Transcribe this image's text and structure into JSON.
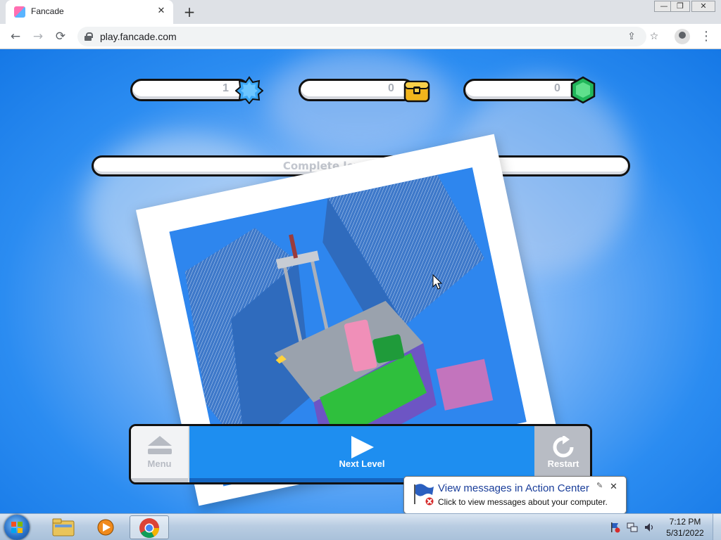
{
  "browser": {
    "tab_title": "Fancade",
    "url": "play.fancade.com",
    "favicon": "fancade-favicon",
    "buttons": {
      "back": "←",
      "forward": "→",
      "reload": "⟳",
      "close_tab": "✕",
      "new_tab": "+",
      "share": "⇪",
      "bookmark": "☆",
      "menu": "⋮"
    },
    "window_controls": {
      "minimize": "—",
      "restore": "❐",
      "close": "✕"
    }
  },
  "game": {
    "counters": {
      "stars": "1",
      "chests": "0",
      "gems": "0"
    },
    "progress_text": "Complete level to earn 1★",
    "buttons": {
      "menu": "Menu",
      "next": "Next Level",
      "restart": "Restart"
    },
    "colors": {
      "accent": "#1e8ef0",
      "star": "#3aa7f5",
      "chest": "#f2b51c",
      "gem": "#21b65a"
    }
  },
  "notification": {
    "title": "View messages in Action Center",
    "text": "Click to view messages about your computer.",
    "close": "✕",
    "pin": "✎"
  },
  "taskbar": {
    "time": "7:12 PM",
    "date": "5/31/2022",
    "apps": [
      "file-explorer",
      "media-player",
      "chrome"
    ]
  }
}
